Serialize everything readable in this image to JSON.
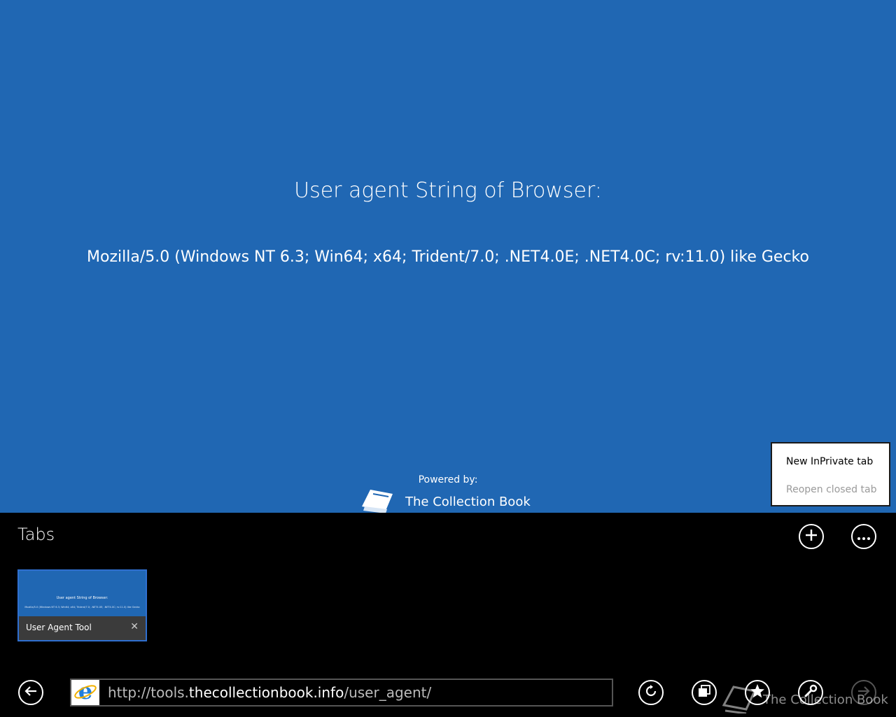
{
  "page": {
    "heading": "User agent String of Browser:",
    "ua_string": "Mozilla/5.0 (Windows NT 6.3; Win64; x64; Trident/7.0; .NET4.0E; .NET4.0C; rv:11.0) like Gecko",
    "powered_by": "Powered by:",
    "brand_name": "The Collection Book"
  },
  "context_menu": {
    "items": [
      "New InPrivate tab",
      "Reopen closed tab"
    ]
  },
  "tabs_panel": {
    "heading": "Tabs",
    "new_tab_icon": "plus-icon",
    "more_icon": "ellipsis-icon",
    "tabs": [
      {
        "label": "User Agent Tool",
        "thumb_title": "User agent String of Browser:",
        "thumb_ua": "Mozilla/5.0 (Windows NT 6.3; Win64; x64; Trident/7.0; .NET4.0E; .NET4.0C; rv:11.0) like Gecko"
      }
    ]
  },
  "address_bar": {
    "url_prefix": "http://tools.",
    "url_domain": "thecollectionbook.info",
    "url_suffix": "/user_agent/"
  },
  "toolbar": {
    "icons": [
      "back-icon",
      "refresh-icon",
      "tabs-icon",
      "favorites-icon",
      "tools-icon",
      "forward-icon"
    ]
  },
  "watermark": "The Collection Book",
  "colors": {
    "page_bg": "#2067b3",
    "app_bar_bg": "#000000",
    "tab_border": "#2f6fd0",
    "disabled_text": "#9a9a9a"
  }
}
